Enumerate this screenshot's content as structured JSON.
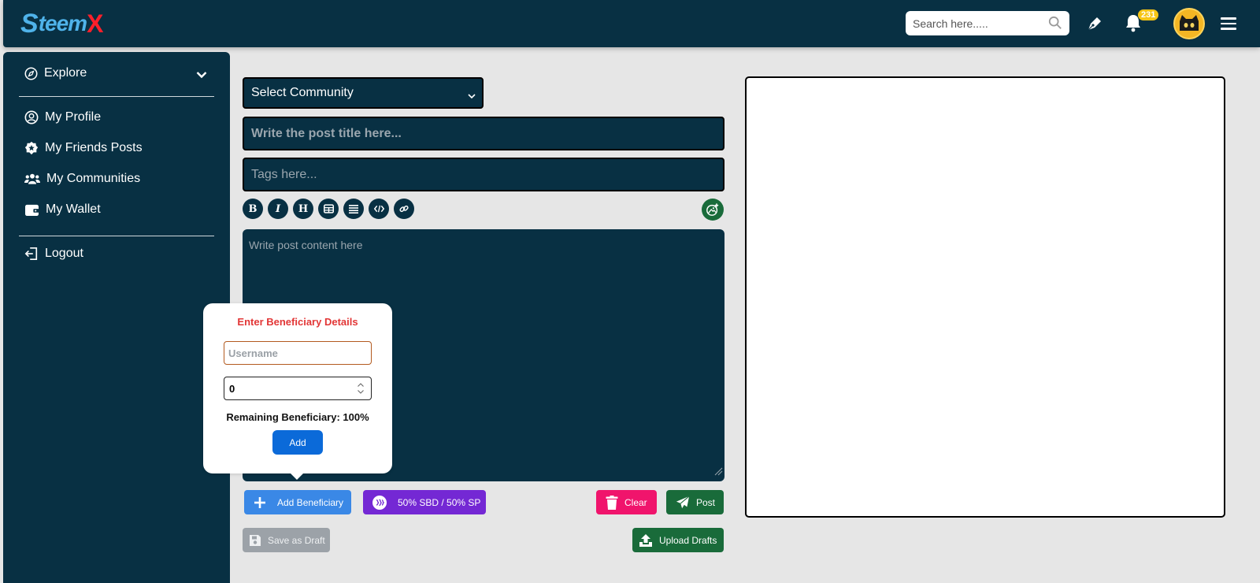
{
  "header": {
    "logo": {
      "s": "S",
      "teem": "teem",
      "x": "X"
    },
    "search_placeholder": "Search here.....",
    "notification_count": "231"
  },
  "sidebar": {
    "explore_label": "Explore",
    "items": [
      {
        "label": "My Profile",
        "icon": "user-circle-icon"
      },
      {
        "label": "My Friends Posts",
        "icon": "star-badge-icon"
      },
      {
        "label": "My Communities",
        "icon": "users-icon"
      },
      {
        "label": "My Wallet",
        "icon": "wallet-icon"
      }
    ],
    "logout_label": "Logout"
  },
  "editor": {
    "community_select": "Select Community",
    "title_placeholder": "Write the post title here...",
    "tags_placeholder": "Tags here...",
    "toolbar": [
      {
        "icon": "bold-icon",
        "glyph": "B"
      },
      {
        "icon": "italic-icon",
        "glyph": "I"
      },
      {
        "icon": "heading-icon",
        "glyph": "H"
      },
      {
        "icon": "table-icon"
      },
      {
        "icon": "list-icon"
      },
      {
        "icon": "code-icon"
      },
      {
        "icon": "link-icon"
      }
    ],
    "content_placeholder": "Write post content here"
  },
  "buttons": {
    "add_beneficiary": "Add Beneficiary",
    "payout_split": "50% SBD / 50% SP",
    "clear": "Clear",
    "post": "Post",
    "save_draft": "Save as Draft",
    "upload_drafts": "Upload Drafts"
  },
  "beneficiary_popup": {
    "title": "Enter Beneficiary Details",
    "username_placeholder": "Username",
    "weight_value": "0",
    "remaining": "Remaining Beneficiary: 100%",
    "add_label": "Add"
  },
  "colors": {
    "primary_dark": "#083043",
    "green": "#196b3a",
    "blue": "#3a88e6",
    "purple": "#7428d4",
    "pink": "#f0146c",
    "popup_title": "#e23636"
  }
}
